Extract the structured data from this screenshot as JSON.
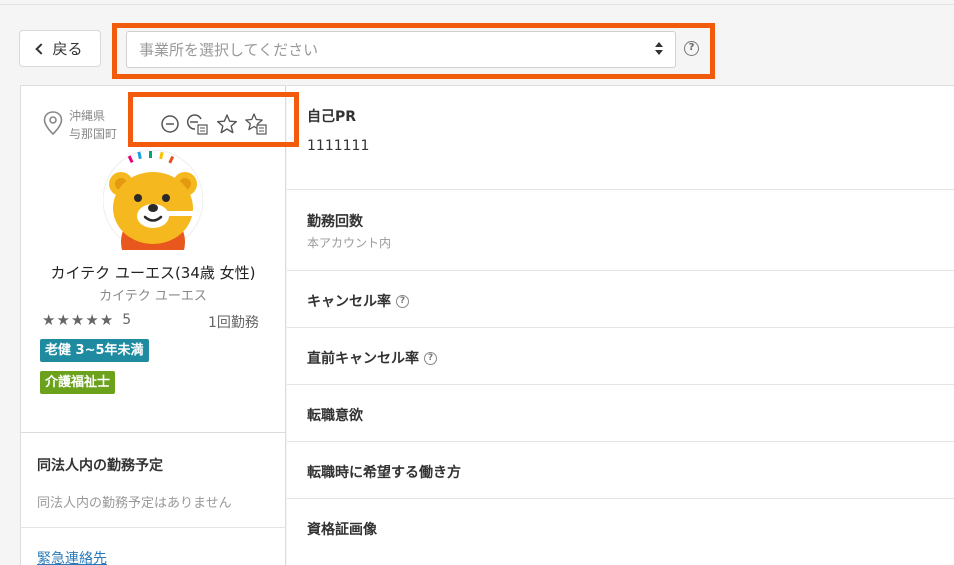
{
  "header": {
    "back_label": "戻る",
    "office_select": {
      "placeholder": "事業所を選択してください",
      "help": "?"
    }
  },
  "profile": {
    "location": {
      "prefecture": "沖縄県",
      "city": "与那国町"
    },
    "name": "カイテク ユーエス(34歳 女性)",
    "kana": "カイテク ユーエス",
    "rating": 5,
    "rating_label": "5",
    "work_count": "1回勤務",
    "badges": {
      "experience": "老健 3~5年未満",
      "license": "介護福祉士"
    },
    "stars": [
      "★",
      "★",
      "★",
      "★",
      "★"
    ]
  },
  "left_sections": {
    "schedule_title": "同法人内の勤務予定",
    "schedule_empty": "同法人内の勤務予定はありません",
    "emergency_link": "緊急連絡先"
  },
  "details": {
    "self_pr": {
      "label": "自己PR",
      "value": "1111111"
    },
    "work_count": {
      "label": "勤務回数",
      "sub": "本アカウント内"
    },
    "cancel_rate": {
      "label": "キャンセル率",
      "help": "?"
    },
    "last_minute_cancel": {
      "label": "直前キャンセル率",
      "help": "?"
    },
    "job_change_intent": {
      "label": "転職意欲"
    },
    "preferred_style": {
      "label": "転職時に希望する働き方"
    },
    "license_image": {
      "label": "資格証画像"
    }
  },
  "colors": {
    "highlight": "#f25a0c",
    "badge_blue": "#1e8ba0",
    "badge_green": "#6ba11b",
    "link": "#2a7ab8"
  }
}
